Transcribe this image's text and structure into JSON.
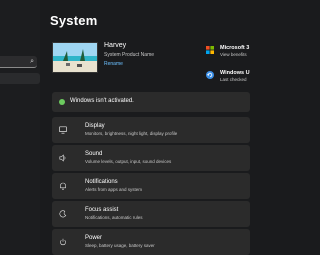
{
  "sidebar": {
    "search_icon": "search-icon"
  },
  "header": {
    "title": "System"
  },
  "device": {
    "name": "Harvey",
    "product": "System Product Name",
    "rename_label": "Rename"
  },
  "quick_links": [
    {
      "icon": "microsoft-365-icon",
      "title": "Microsoft 3",
      "subtitle": "View benefits"
    },
    {
      "icon": "windows-update-icon",
      "title": "Windows U",
      "subtitle": "Last checked"
    }
  ],
  "activation_banner": {
    "text": "Windows isn't activated.",
    "status_color": "#6ccb5f"
  },
  "settings": [
    {
      "icon": "display-icon",
      "title": "Display",
      "subtitle": "Monitors, brightness, night light, display profile"
    },
    {
      "icon": "sound-icon",
      "title": "Sound",
      "subtitle": "Volume levels, output, input, sound devices"
    },
    {
      "icon": "notifications-icon",
      "title": "Notifications",
      "subtitle": "Alerts from apps and system"
    },
    {
      "icon": "focus-assist-icon",
      "title": "Focus assist",
      "subtitle": "Notifications, automatic rules"
    },
    {
      "icon": "power-icon",
      "title": "Power",
      "subtitle": "Sleep, battery usage, battery saver"
    }
  ],
  "colors": {
    "accent": "#6cc0ff",
    "background": "#1a1b1d",
    "card": "#2b2b2b"
  }
}
